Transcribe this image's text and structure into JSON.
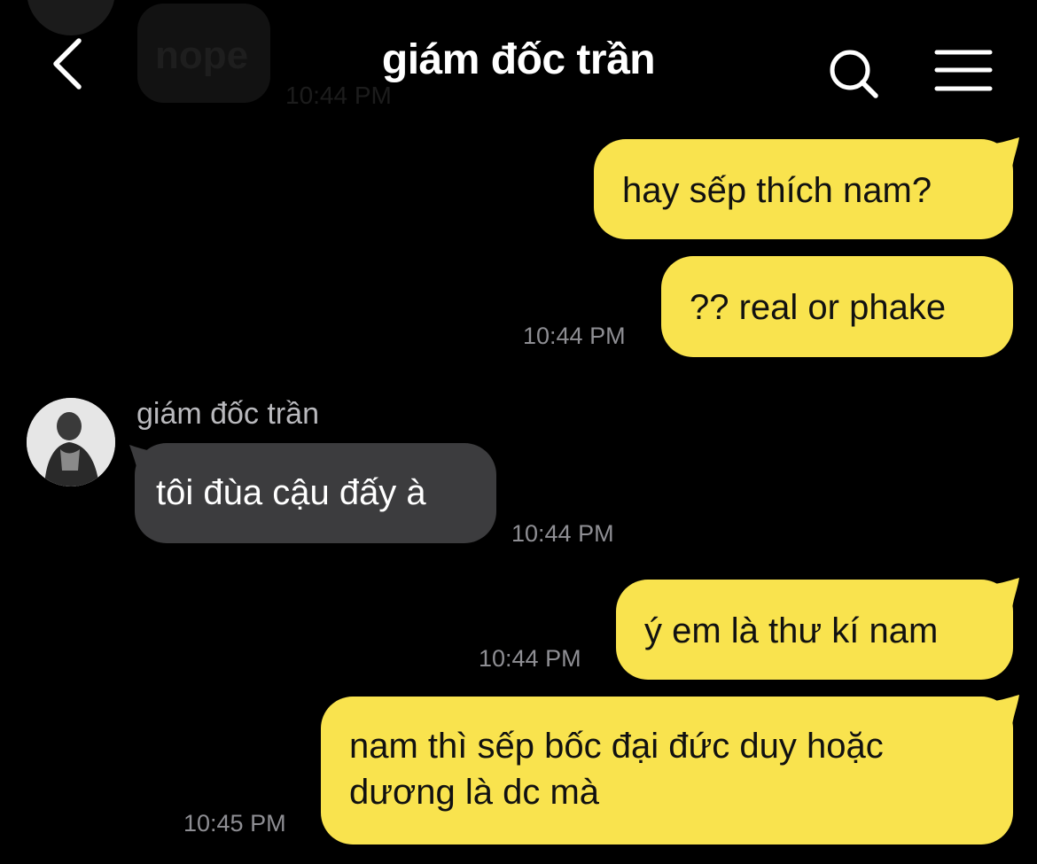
{
  "header": {
    "title": "giám đốc trần",
    "back_icon": "chevron-left-icon",
    "search_icon": "search-icon",
    "menu_icon": "hamburger-menu-icon"
  },
  "previous": {
    "text": "nope",
    "time": "10:44 PM"
  },
  "messages": [
    {
      "direction": "outgoing",
      "lines": [
        "hay sếp thích nam?"
      ]
    },
    {
      "direction": "outgoing",
      "lines": [
        "?? real or phake"
      ],
      "time": "10:44 PM"
    },
    {
      "direction": "incoming",
      "sender": "giám đốc trần",
      "lines": [
        "tôi đùa cậu đấy à"
      ],
      "time": "10:44 PM"
    },
    {
      "direction": "outgoing",
      "lines": [
        "ý em là thư kí nam"
      ],
      "time": "10:44 PM"
    },
    {
      "direction": "outgoing",
      "lines": [
        "nam thì sếp bốc đại đức duy hoặc",
        "dương là dc mà"
      ],
      "time": "10:45 PM"
    }
  ],
  "colors": {
    "background": "#000000",
    "outgoing_bubble": "#f9e34e",
    "incoming_bubble": "#3c3c3e",
    "timestamp": "#8e8e93"
  }
}
